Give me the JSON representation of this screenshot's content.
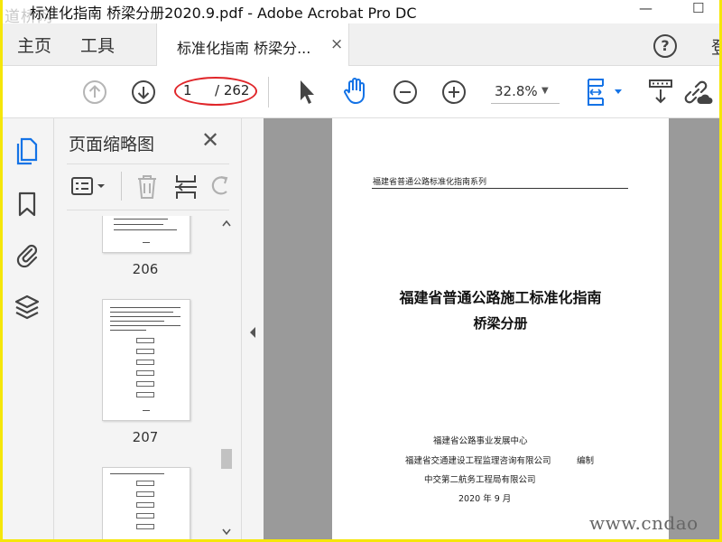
{
  "window": {
    "title": "标准化指南 桥梁分册2020.9.pdf - Adobe Acrobat Pro DC",
    "watermark_top": "道桥网",
    "minimize": "—",
    "maximize": "☐"
  },
  "tabs": {
    "home": "主页",
    "tools": "工具",
    "doc_tab": "标准化指南 桥梁分...",
    "close": "×",
    "help": "?",
    "signin": "登"
  },
  "toolbar": {
    "page_current": "1",
    "page_total": "/ 262",
    "zoom": "32.8%",
    "zoom_caret": "▼",
    "icons": [
      "prev-page-icon",
      "next-page-icon",
      "select-pointer-icon",
      "hand-tool-icon",
      "zoom-out-icon",
      "zoom-in-icon",
      "fit-page-icon",
      "scroll-mode-icon",
      "share-link-icon"
    ]
  },
  "sidebar": {
    "icons": [
      "page-thumbnails-icon",
      "bookmarks-icon",
      "attachments-icon",
      "layers-icon"
    ]
  },
  "panel": {
    "title": "页面缩略图",
    "close": "✕",
    "thumbnails": [
      {
        "number": "206"
      },
      {
        "number": "207"
      }
    ]
  },
  "document": {
    "series": "福建省普通公路标准化指南系列",
    "title_line1": "福建省普通公路施工标准化指南",
    "title_line2": "桥梁分册",
    "publisher1": "福建省公路事业发展中心",
    "publisher2": "福建省交通建设工程监理咨询有限公司",
    "edit_label": "编制",
    "publisher3": "中交第二航务工程局有限公司",
    "date": "2020 年 9 月"
  },
  "watermark_bottom": "www.cndao",
  "colors": {
    "frame": "#f5e60a",
    "accent": "#1473e6",
    "highlight_ellipse": "#e0262a",
    "viewer_bg": "#9a9a9a"
  }
}
